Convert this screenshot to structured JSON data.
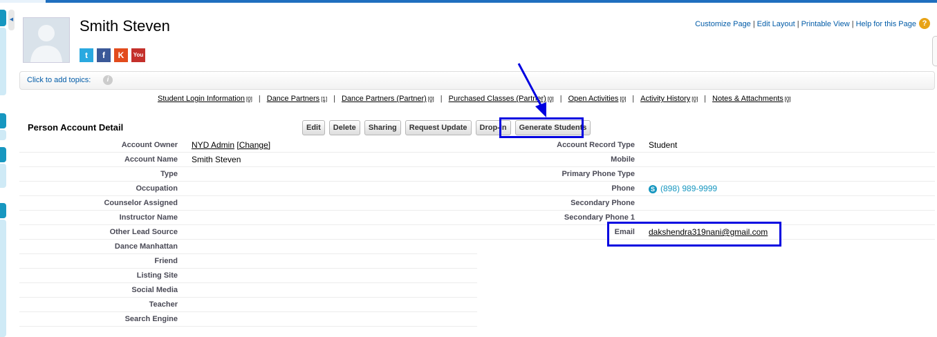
{
  "header": {
    "title": "Smith Steven",
    "social": [
      {
        "name": "twitter",
        "label": "t",
        "color": "#2aa9e0"
      },
      {
        "name": "facebook",
        "label": "f",
        "color": "#3b5998"
      },
      {
        "name": "klout",
        "label": "K",
        "color": "#e24b1c"
      },
      {
        "name": "youtube",
        "label": "You",
        "color": "#c4302b"
      }
    ]
  },
  "toplinks": [
    "Customize Page",
    "Edit Layout",
    "Printable View",
    "Help for this Page"
  ],
  "topics": {
    "label": "Click to add topics:"
  },
  "related": [
    {
      "label": "Student Login Information",
      "count": "[0]"
    },
    {
      "label": "Dance Partners",
      "count": "[1]"
    },
    {
      "label": "Dance Partners (Partner)",
      "count": "[0]"
    },
    {
      "label": "Purchased Classes (Partner)",
      "count": "[0]"
    },
    {
      "label": "Open Activities",
      "count": "[0]"
    },
    {
      "label": "Activity History",
      "count": "[0]"
    },
    {
      "label": "Notes & Attachments",
      "count": "[0]"
    }
  ],
  "detail": {
    "title": "Person Account Detail",
    "buttons": [
      "Edit",
      "Delete",
      "Sharing",
      "Request Update",
      "Drop-In",
      "Generate Students"
    ],
    "left": [
      {
        "label": "Account Owner",
        "value": "NYD Admin",
        "link": "[Change]"
      },
      {
        "label": "Account Name",
        "value": "Smith Steven"
      },
      {
        "label": "Type",
        "value": ""
      },
      {
        "label": "Occupation",
        "value": ""
      },
      {
        "label": "Counselor Assigned",
        "value": ""
      },
      {
        "label": "Instructor Name",
        "value": ""
      },
      {
        "label": "Other Lead Source",
        "value": ""
      },
      {
        "label": "Dance Manhattan",
        "value": ""
      },
      {
        "label": "Friend",
        "value": ""
      },
      {
        "label": "Listing Site",
        "value": ""
      },
      {
        "label": "Social Media",
        "value": ""
      },
      {
        "label": "Teacher",
        "value": ""
      },
      {
        "label": "Search Engine",
        "value": ""
      }
    ],
    "right": [
      {
        "label": "Account Record Type",
        "value": "Student"
      },
      {
        "label": "Mobile",
        "value": ""
      },
      {
        "label": "Primary Phone Type",
        "value": ""
      },
      {
        "label": "Phone",
        "value": "(898) 989-9999"
      },
      {
        "label": "Secondary Phone",
        "value": ""
      },
      {
        "label": "Secondary Phone 1",
        "value": ""
      },
      {
        "label": "Email",
        "value": "dakshendra319nani@gmail.com"
      }
    ]
  },
  "colors": {
    "annotation": "#0000e0",
    "link": "#015ba7",
    "brand": "#1797c0"
  }
}
